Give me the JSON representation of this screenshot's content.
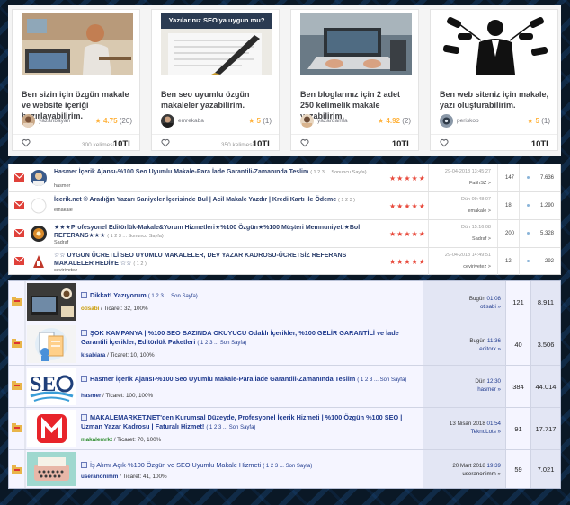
{
  "cards": [
    {
      "title": "Ben sizin için özgün makale ve website içeriği hazırlayabilirim.",
      "seller": "yazanbayan",
      "rating": "4.75",
      "reviews": "(20)",
      "price_label": "300 kelimesi",
      "price": "10TL",
      "thumb": "person-at-desk"
    },
    {
      "title": "Ben seo uyumlu özgün makaleler yazabilirim.",
      "seller": "emrekaba",
      "rating": "5",
      "reviews": "(1)",
      "price_label": "350 kelimesi",
      "price": "10TL",
      "thumb_caption": "Yazılarınız SEO'ya uygun mu?"
    },
    {
      "title": "Ben bloglarınız için 2 adet 250 kelimelik makale yazabilirim.",
      "seller": "yazardamla",
      "rating": "4.92",
      "reviews": "(2)",
      "price_label": "",
      "price": "10TL",
      "thumb": "laptop-typing"
    },
    {
      "title": "Ben web siteniz için makale, yazı oluşturabilirim.",
      "seller": "periskop",
      "rating": "5",
      "reviews": "(1)",
      "price_label": "",
      "price": "10TL",
      "thumb": "man-with-microphones"
    }
  ],
  "forum_list": [
    {
      "title": "Hasmer İçerik Ajansı-%100 Seo Uyumlu Makale-Para İade Garantili-Zamanında Teslim",
      "pages": "( 1 2 3 ... Sonuncu Sayfa)",
      "author": "hasmer",
      "stars": "★★★★★",
      "date": "29-04-2018 13:45:27",
      "last_user": "FatihSZ >",
      "replies": "147",
      "views": "7.636"
    },
    {
      "title": "İcerik.net ® Aradığın Yazarı Saniyeler İçerisinde Bul | Acil Makale Yazdır | Kredi Kartı ile Ödeme",
      "pages": "( 1 2 3 )",
      "author": "emakale",
      "stars": "★★★★★",
      "date": "Dün 09:48:07",
      "last_user": "emakale >",
      "replies": "18",
      "views": "1.290"
    },
    {
      "title": "★★★Profesyonel Editörlük-Makale&Yorum Hizmetleri★%100 Özgün★%100 Müşteri Memnuniyeti★Bol REFERANS★★★",
      "pages": "( 1 2 3 ... Sonuncu Sayfa)",
      "author": "Sadraf",
      "stars": "★★★★★",
      "date": "Dün 15:16:08",
      "last_user": "Sadraf >",
      "replies": "200",
      "views": "5.328"
    },
    {
      "title": "☆☆ UYGUN ÜCRETLİ SEO UYUMLU MAKALELER, DEV YAZAR KADROSU-ÜCRETSİZ REFERANS MAKALELER HEDİYE ☆☆",
      "pages": "( 1 2 )",
      "author": "cevirivetez",
      "stars": "★★★★★",
      "date": "29-04-2018 14:49:51",
      "last_user": "cevirivetez >",
      "replies": "12",
      "views": "292"
    }
  ],
  "vb_list": [
    {
      "title": "Dikkat! Yazıyorum",
      "pages": "( 1 2 3 ... Son Sayfa)",
      "author": "otisabi",
      "trade": "/ Ticaret: 32, 100%",
      "date": "Bugün",
      "time": "01:08",
      "last_user": "otisabi »",
      "replies": "121",
      "views": "8.911",
      "thumb": "coffee-laptop"
    },
    {
      "title": "ŞOK KAMPANYA | %100 SEO BAZINDA OKUYUCU Odaklı İçerikler, %100 GELİR GARANTİLİ ve İade Garantili İçerikler, Editörlük Paketleri",
      "pages": "( 1 2 3 ... Son Sayfa)",
      "author": "kisabiara",
      "trade": "/ Ticaret: 10, 100%",
      "date": "Bugün",
      "time": "11:36",
      "last_user": "editorx »",
      "replies": "40",
      "views": "3.506",
      "thumb": "document-person"
    },
    {
      "title": "Hasmer İçerik Ajansı-%100 Seo Uyumlu Makale-Para İade Garantili-Zamanında Teslim",
      "pages": "( 1 2 3 ... Son Sayfa)",
      "author": "hasmer",
      "trade": "/ Ticaret: 100, 100%",
      "date": "Dün",
      "time": "12:30",
      "last_user": "hasmer »",
      "replies": "384",
      "views": "44.014",
      "thumb": "seo-logo"
    },
    {
      "title": "MAKALEMARKET.NET'den Kurumsal Düzeyde, Profesyonel İçerik Hizmeti | %100 Özgün %100 SEO | Uzman Yazar Kadrosu | Faturalı Hizmet!",
      "pages": "( 1 2 3 ... Son Sayfa)",
      "author": "makalemrkt",
      "trade": "/ Ticaret: 70, 100%",
      "date": "13 Nisan 2018",
      "time": "01:54",
      "last_user": "TeknoLots »",
      "replies": "91",
      "views": "17.717",
      "thumb": "m-logo"
    },
    {
      "title": "İş Alımı Açık-%100 Özgün ve SEO Uyumlu Makale Hizmeti",
      "pages": "( 1 2 3 ... Son Sayfa)",
      "author": "useranonimm",
      "trade": "/ Ticaret: 41, 100%",
      "date": "20 Mart 2018",
      "time": "19:39",
      "last_user": "useranonimm »",
      "replies": "59",
      "views": "7.021",
      "thumb": "typewriter"
    }
  ],
  "colors": {
    "star": "#ffb33e",
    "forum_star": "#e84a3c",
    "vb_link": "#1f3a8e",
    "mail": "#e0413a"
  }
}
